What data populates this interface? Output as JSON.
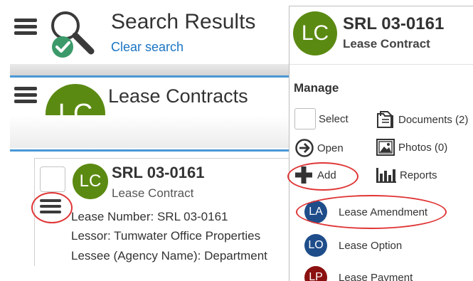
{
  "search": {
    "title": "Search Results",
    "clear_label": "Clear search"
  },
  "list": {
    "title": "Lease Contracts",
    "avatar": "LC"
  },
  "card": {
    "avatar": "LC",
    "title": "SRL 03-0161",
    "subtitle": "Lease Contract",
    "fields": [
      "Lease Number: SRL 03-0161",
      "Lessor: Tumwater Office Properties",
      "Lessee (Agency Name): Department"
    ]
  },
  "panel": {
    "avatar": "LC",
    "title": "SRL 03-0161",
    "subtitle": "Lease Contract",
    "section_label": "Manage",
    "actions": {
      "select": "Select",
      "documents": "Documents (2)",
      "open": "Open",
      "photos": "Photos (0)",
      "add": "Add",
      "reports": "Reports"
    },
    "add_items": [
      {
        "abbr": "LA",
        "label": "Lease Amendment"
      },
      {
        "abbr": "LO",
        "label": "Lease Option"
      },
      {
        "abbr": "LP",
        "label": "Lease Payment"
      }
    ]
  },
  "colors": {
    "avatar_green": "#5b8a12",
    "link_blue": "#1a75c4",
    "highlight_red": "#e03535",
    "sub_avatar_blue": "#1e4d8a",
    "sub_avatar_red": "#8b1111"
  }
}
